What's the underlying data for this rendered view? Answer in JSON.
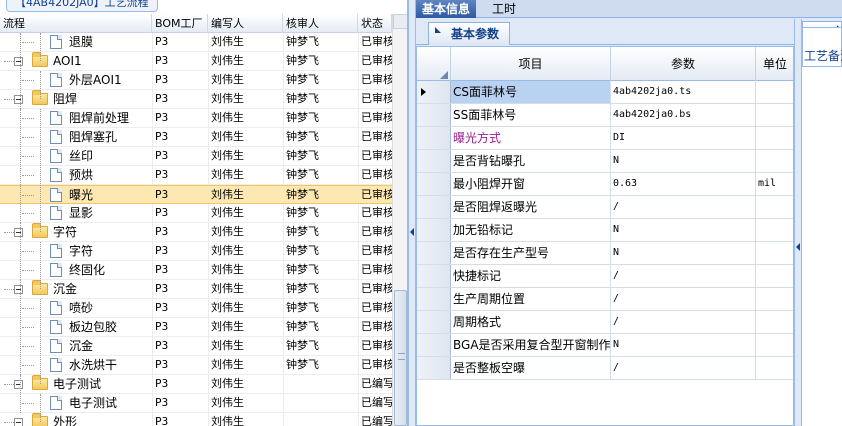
{
  "left_panel": {
    "title": "【4AB4202JA0】工艺流程",
    "columns": [
      "流程",
      "BOM工厂",
      "编写人",
      "核审人",
      "状态"
    ],
    "rows": [
      {
        "name": "退膜",
        "level": 2,
        "kind": "doc",
        "bom": "P3",
        "writer": "刘伟生",
        "checker": "钟梦飞",
        "status": "已审核"
      },
      {
        "name": "AOI1",
        "level": 1,
        "kind": "folder",
        "bom": "P3",
        "writer": "刘伟生",
        "checker": "钟梦飞",
        "status": "已审核"
      },
      {
        "name": "外层AOI1",
        "level": 2,
        "kind": "doc",
        "bom": "P3",
        "writer": "刘伟生",
        "checker": "钟梦飞",
        "status": "已审核"
      },
      {
        "name": "阻焊",
        "level": 1,
        "kind": "folder",
        "bom": "P3",
        "writer": "刘伟生",
        "checker": "钟梦飞",
        "status": "已审核"
      },
      {
        "name": "阻焊前处理",
        "level": 2,
        "kind": "doc",
        "bom": "P3",
        "writer": "刘伟生",
        "checker": "钟梦飞",
        "status": "已审核"
      },
      {
        "name": "阻焊塞孔",
        "level": 2,
        "kind": "doc",
        "bom": "P3",
        "writer": "刘伟生",
        "checker": "钟梦飞",
        "status": "已审核"
      },
      {
        "name": "丝印",
        "level": 2,
        "kind": "doc",
        "bom": "P3",
        "writer": "刘伟生",
        "checker": "钟梦飞",
        "status": "已审核"
      },
      {
        "name": "预烘",
        "level": 2,
        "kind": "doc",
        "bom": "P3",
        "writer": "刘伟生",
        "checker": "钟梦飞",
        "status": "已审核"
      },
      {
        "name": "曝光",
        "level": 2,
        "kind": "doc",
        "bom": "P3",
        "writer": "刘伟生",
        "checker": "钟梦飞",
        "status": "已审核",
        "selected": true
      },
      {
        "name": "显影",
        "level": 2,
        "kind": "doc",
        "bom": "P3",
        "writer": "刘伟生",
        "checker": "钟梦飞",
        "status": "已审核"
      },
      {
        "name": "字符",
        "level": 1,
        "kind": "folder",
        "bom": "P3",
        "writer": "刘伟生",
        "checker": "钟梦飞",
        "status": "已审核"
      },
      {
        "name": "字符",
        "level": 2,
        "kind": "doc",
        "bom": "P3",
        "writer": "刘伟生",
        "checker": "钟梦飞",
        "status": "已审核"
      },
      {
        "name": "终固化",
        "level": 2,
        "kind": "doc",
        "bom": "P3",
        "writer": "刘伟生",
        "checker": "钟梦飞",
        "status": "已审核"
      },
      {
        "name": "沉金",
        "level": 1,
        "kind": "folder",
        "bom": "P3",
        "writer": "刘伟生",
        "checker": "钟梦飞",
        "status": "已审核"
      },
      {
        "name": "喷砂",
        "level": 2,
        "kind": "doc",
        "bom": "P3",
        "writer": "刘伟生",
        "checker": "钟梦飞",
        "status": "已审核"
      },
      {
        "name": "板边包胶",
        "level": 2,
        "kind": "doc",
        "bom": "P3",
        "writer": "刘伟生",
        "checker": "钟梦飞",
        "status": "已审核"
      },
      {
        "name": "沉金",
        "level": 2,
        "kind": "doc",
        "bom": "P3",
        "writer": "刘伟生",
        "checker": "钟梦飞",
        "status": "已审核"
      },
      {
        "name": "水洗烘干",
        "level": 2,
        "kind": "doc",
        "bom": "P3",
        "writer": "刘伟生",
        "checker": "钟梦飞",
        "status": "已审核"
      },
      {
        "name": "电子测试",
        "level": 1,
        "kind": "folder",
        "bom": "P3",
        "writer": "刘伟生",
        "checker": "",
        "status": "已编写"
      },
      {
        "name": "电子测试",
        "level": 2,
        "kind": "doc",
        "bom": "P3",
        "writer": "刘伟生",
        "checker": "",
        "status": "已编写"
      },
      {
        "name": "外形",
        "level": 1,
        "kind": "folder",
        "bom": "P3",
        "writer": "刘伟生",
        "checker": "",
        "status": "已编写"
      }
    ]
  },
  "right_panel": {
    "top_tabs": [
      "基本信息",
      "工时"
    ],
    "active_top_tab": "基本信息",
    "sub_tab": "基本参数",
    "side_tab": "工艺备注",
    "grid_columns": [
      "项目",
      "参数",
      "单位"
    ],
    "grid_rows": [
      {
        "item": "CS面菲林号",
        "param": "4ab4202ja0.ts",
        "unit": "",
        "current": true
      },
      {
        "item": "SS面菲林号",
        "param": "4ab4202ja0.bs",
        "unit": ""
      },
      {
        "item": "曝光方式",
        "param": "DI",
        "unit": "",
        "color": "#9b1e8e"
      },
      {
        "item": "是否背钻曝孔",
        "param": "N",
        "unit": ""
      },
      {
        "item": "最小阻焊开窗",
        "param": "0.63",
        "unit": "mil"
      },
      {
        "item": "是否阻焊返曝光",
        "param": "/",
        "unit": ""
      },
      {
        "item": "加无铅标记",
        "param": "N",
        "unit": ""
      },
      {
        "item": "是否存在生产型号",
        "param": "N",
        "unit": ""
      },
      {
        "item": "快捷标记",
        "param": "/",
        "unit": ""
      },
      {
        "item": "生产周期位置",
        "param": "/",
        "unit": ""
      },
      {
        "item": "周期格式",
        "param": "/",
        "unit": ""
      },
      {
        "item": "BGA是否采用复合型开窗制作",
        "param": "N",
        "unit": ""
      },
      {
        "item": "是否整板空曝",
        "param": "/",
        "unit": ""
      }
    ]
  },
  "icons": {
    "folder": "folder-icon",
    "document": "document-icon",
    "expander": "collapse-minus-icon",
    "row_pointer": "row-pointer-icon"
  }
}
